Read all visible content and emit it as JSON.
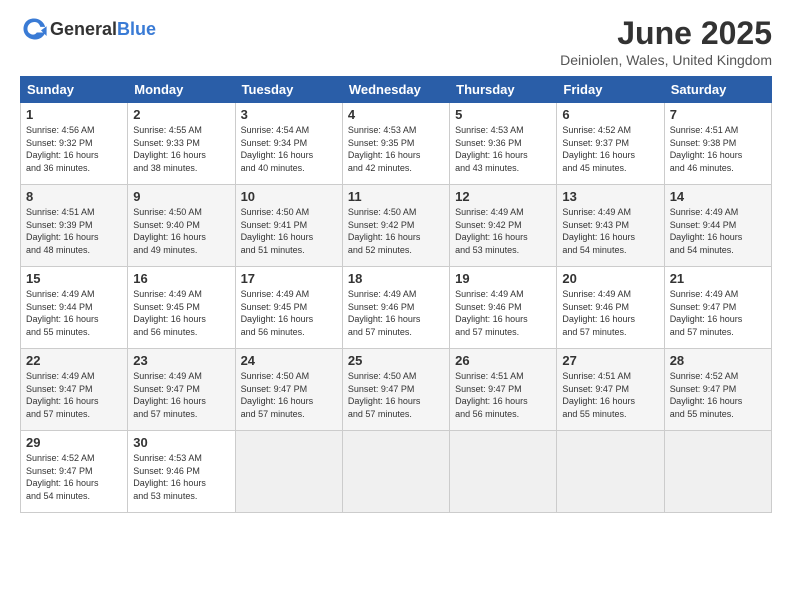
{
  "logo": {
    "general": "General",
    "blue": "Blue"
  },
  "title": "June 2025",
  "location": "Deiniolen, Wales, United Kingdom",
  "weekdays": [
    "Sunday",
    "Monday",
    "Tuesday",
    "Wednesday",
    "Thursday",
    "Friday",
    "Saturday"
  ],
  "weeks": [
    [
      {
        "day": "1",
        "sunrise": "4:56 AM",
        "sunset": "9:32 PM",
        "daylight": "16 hours and 36 minutes."
      },
      {
        "day": "2",
        "sunrise": "4:55 AM",
        "sunset": "9:33 PM",
        "daylight": "16 hours and 38 minutes."
      },
      {
        "day": "3",
        "sunrise": "4:54 AM",
        "sunset": "9:34 PM",
        "daylight": "16 hours and 40 minutes."
      },
      {
        "day": "4",
        "sunrise": "4:53 AM",
        "sunset": "9:35 PM",
        "daylight": "16 hours and 42 minutes."
      },
      {
        "day": "5",
        "sunrise": "4:53 AM",
        "sunset": "9:36 PM",
        "daylight": "16 hours and 43 minutes."
      },
      {
        "day": "6",
        "sunrise": "4:52 AM",
        "sunset": "9:37 PM",
        "daylight": "16 hours and 45 minutes."
      },
      {
        "day": "7",
        "sunrise": "4:51 AM",
        "sunset": "9:38 PM",
        "daylight": "16 hours and 46 minutes."
      }
    ],
    [
      {
        "day": "8",
        "sunrise": "4:51 AM",
        "sunset": "9:39 PM",
        "daylight": "16 hours and 48 minutes."
      },
      {
        "day": "9",
        "sunrise": "4:50 AM",
        "sunset": "9:40 PM",
        "daylight": "16 hours and 49 minutes."
      },
      {
        "day": "10",
        "sunrise": "4:50 AM",
        "sunset": "9:41 PM",
        "daylight": "16 hours and 51 minutes."
      },
      {
        "day": "11",
        "sunrise": "4:50 AM",
        "sunset": "9:42 PM",
        "daylight": "16 hours and 52 minutes."
      },
      {
        "day": "12",
        "sunrise": "4:49 AM",
        "sunset": "9:42 PM",
        "daylight": "16 hours and 53 minutes."
      },
      {
        "day": "13",
        "sunrise": "4:49 AM",
        "sunset": "9:43 PM",
        "daylight": "16 hours and 54 minutes."
      },
      {
        "day": "14",
        "sunrise": "4:49 AM",
        "sunset": "9:44 PM",
        "daylight": "16 hours and 54 minutes."
      }
    ],
    [
      {
        "day": "15",
        "sunrise": "4:49 AM",
        "sunset": "9:44 PM",
        "daylight": "16 hours and 55 minutes."
      },
      {
        "day": "16",
        "sunrise": "4:49 AM",
        "sunset": "9:45 PM",
        "daylight": "16 hours and 56 minutes."
      },
      {
        "day": "17",
        "sunrise": "4:49 AM",
        "sunset": "9:45 PM",
        "daylight": "16 hours and 56 minutes."
      },
      {
        "day": "18",
        "sunrise": "4:49 AM",
        "sunset": "9:46 PM",
        "daylight": "16 hours and 57 minutes."
      },
      {
        "day": "19",
        "sunrise": "4:49 AM",
        "sunset": "9:46 PM",
        "daylight": "16 hours and 57 minutes."
      },
      {
        "day": "20",
        "sunrise": "4:49 AM",
        "sunset": "9:46 PM",
        "daylight": "16 hours and 57 minutes."
      },
      {
        "day": "21",
        "sunrise": "4:49 AM",
        "sunset": "9:47 PM",
        "daylight": "16 hours and 57 minutes."
      }
    ],
    [
      {
        "day": "22",
        "sunrise": "4:49 AM",
        "sunset": "9:47 PM",
        "daylight": "16 hours and 57 minutes."
      },
      {
        "day": "23",
        "sunrise": "4:49 AM",
        "sunset": "9:47 PM",
        "daylight": "16 hours and 57 minutes."
      },
      {
        "day": "24",
        "sunrise": "4:50 AM",
        "sunset": "9:47 PM",
        "daylight": "16 hours and 57 minutes."
      },
      {
        "day": "25",
        "sunrise": "4:50 AM",
        "sunset": "9:47 PM",
        "daylight": "16 hours and 57 minutes."
      },
      {
        "day": "26",
        "sunrise": "4:51 AM",
        "sunset": "9:47 PM",
        "daylight": "16 hours and 56 minutes."
      },
      {
        "day": "27",
        "sunrise": "4:51 AM",
        "sunset": "9:47 PM",
        "daylight": "16 hours and 55 minutes."
      },
      {
        "day": "28",
        "sunrise": "4:52 AM",
        "sunset": "9:47 PM",
        "daylight": "16 hours and 55 minutes."
      }
    ],
    [
      {
        "day": "29",
        "sunrise": "4:52 AM",
        "sunset": "9:47 PM",
        "daylight": "16 hours and 54 minutes."
      },
      {
        "day": "30",
        "sunrise": "4:53 AM",
        "sunset": "9:46 PM",
        "daylight": "16 hours and 53 minutes."
      },
      null,
      null,
      null,
      null,
      null
    ]
  ]
}
